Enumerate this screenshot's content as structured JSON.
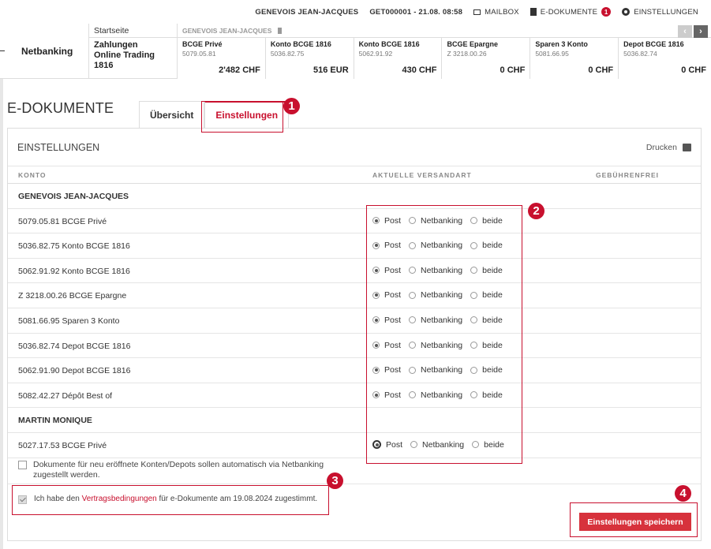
{
  "topbar": {
    "user": "GENEVOIS JEAN-JACQUES",
    "session": "GET000001 - 21.08. 08:58",
    "mailbox": "MAILBOX",
    "edocs": "E-DOKUMENTE",
    "edocs_badge": "1",
    "settings": "EINSTELLUNGEN"
  },
  "strip": {
    "netbanking": "Netbanking",
    "home": "Startseite",
    "nav_line1": "Zahlungen",
    "nav_line2": "Online Trading 1816",
    "accounts_owner": "GENEVOIS JEAN-JACQUES",
    "accounts": [
      {
        "name": "BCGE Privé",
        "number": "5079.05.81",
        "value": "2'482 CHF"
      },
      {
        "name": "Konto BCGE 1816",
        "number": "5036.82.75",
        "value": "516 EUR"
      },
      {
        "name": "Konto BCGE 1816",
        "number": "5062.91.92",
        "value": "430 CHF"
      },
      {
        "name": "BCGE Epargne",
        "number": "Z 3218.00.26",
        "value": "0 CHF"
      },
      {
        "name": "Sparen 3 Konto",
        "number": "5081.66.95",
        "value": "0 CHF"
      },
      {
        "name": "Depot BCGE 1816",
        "number": "5036.82.74",
        "value": "0 CHF"
      }
    ]
  },
  "page": {
    "title": "E-DOKUMENTE",
    "tabs": [
      "Übersicht",
      "Einstellungen"
    ]
  },
  "panel": {
    "heading": "EINSTELLUNGEN",
    "print": "Drucken",
    "col_konto": "KONTO",
    "col_versand": "AKTUELLE VERSANDART",
    "col_gebuehr": "GEBÜHRENFREI",
    "options": [
      "Post",
      "Netbanking",
      "beide"
    ],
    "rows": [
      {
        "type": "group",
        "label": "GENEVOIS JEAN-JACQUES"
      },
      {
        "type": "acct",
        "label": "5079.05.81 BCGE Privé"
      },
      {
        "type": "acct",
        "label": "5036.82.75 Konto BCGE 1816"
      },
      {
        "type": "acct",
        "label": "5062.91.92 Konto BCGE 1816"
      },
      {
        "type": "acct",
        "label": "Z 3218.00.26 BCGE Epargne"
      },
      {
        "type": "acct",
        "label": "5081.66.95 Sparen 3 Konto"
      },
      {
        "type": "acct",
        "label": "5036.82.74 Depot BCGE 1816"
      },
      {
        "type": "acct",
        "label": "5062.91.90 Depot BCGE 1816"
      },
      {
        "type": "acct",
        "label": "5082.42.27 Dépôt Best of"
      },
      {
        "type": "group",
        "label": "MARTIN MONIQUE"
      },
      {
        "type": "acct",
        "label": "5027.17.53 BCGE Privé"
      }
    ],
    "auto_line1": "Dokumente für neu eröffnete Konten/Depots sollen automatisch via Netbanking",
    "auto_line2": "zugestellt werden.",
    "agree_pre": "Ich habe den",
    "agree_link": "Vertragsbedingungen",
    "agree_post": "für e-Dokumente am 19.08.2024 zugestimmt.",
    "save": "Einstellungen speichern"
  },
  "markers": [
    "1",
    "2",
    "3",
    "4"
  ]
}
